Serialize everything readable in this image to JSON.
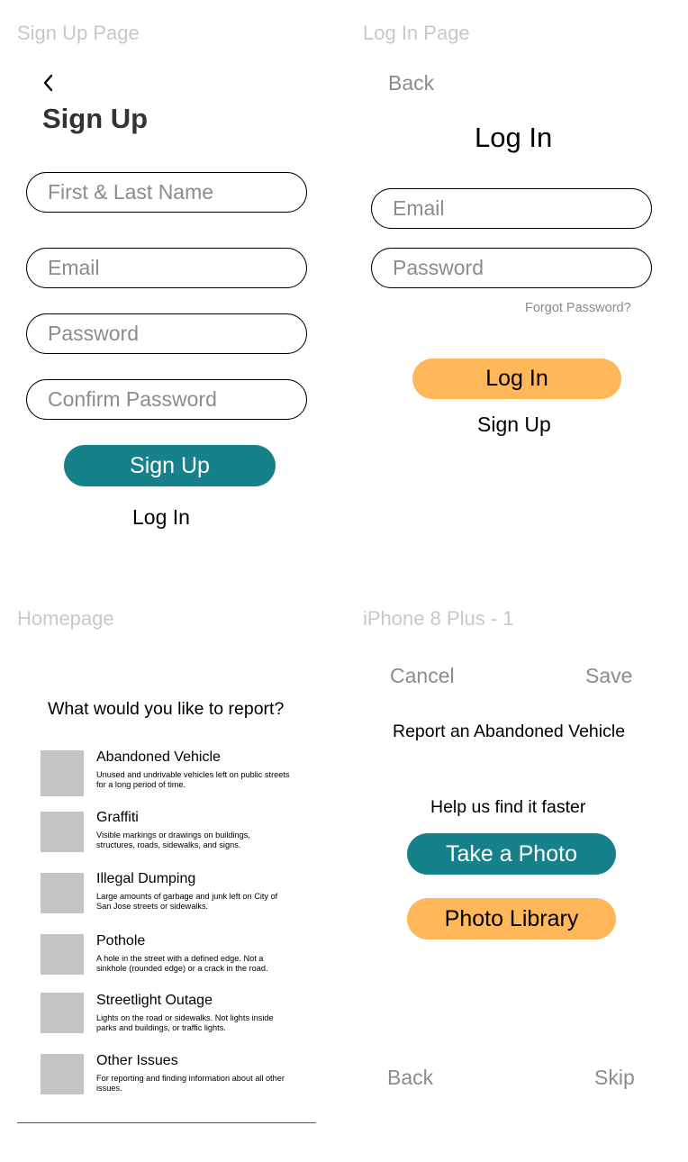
{
  "artboards": {
    "signup": "Sign Up Page",
    "login": "Log In Page",
    "home": "Homepage",
    "iphone": "iPhone 8 Plus - 1"
  },
  "signup": {
    "back_glyph": "‹",
    "title": "Sign Up",
    "name_placeholder": "First & Last Name",
    "email_placeholder": "Email",
    "password_placeholder": "Password",
    "confirm_placeholder": "Confirm Password",
    "submit_label": "Sign Up",
    "login_link": "Log In"
  },
  "login": {
    "back_label": "Back",
    "title": "Log In",
    "email_placeholder": "Email",
    "password_placeholder": "Password",
    "forgot_label": "Forgot Password?",
    "submit_label": "Log In",
    "signup_link": "Sign Up"
  },
  "home": {
    "heading": "What would you like to report?",
    "categories": [
      {
        "title": "Abandoned Vehicle",
        "desc": "Unused and undrivable vehicles left on public streets for a long period of time."
      },
      {
        "title": "Graffiti",
        "desc": "Visible markings or drawings on buildings, structures, roads, sidewalks, and signs."
      },
      {
        "title": "Illegal Dumping",
        "desc": "Large amounts of garbage and junk left on City of San Jose streets or sidewalks."
      },
      {
        "title": "Pothole",
        "desc": "A hole in the street with a defined edge. Not a sinkhole (rounded edge) or a crack in the road."
      },
      {
        "title": "Streetlight Outage",
        "desc": "Lights on the road or sidewalks. Not lights inside parks and buildings, or traffic lights."
      },
      {
        "title": "Other Issues",
        "desc": "For reporting and finding information about all other issues."
      }
    ]
  },
  "report": {
    "cancel_label": "Cancel",
    "save_label": "Save",
    "title": "Report an Abandoned Vehicle",
    "help_text": "Help us find it faster",
    "take_photo_label": "Take a Photo",
    "library_label": "Photo Library",
    "back_label": "Back",
    "skip_label": "Skip"
  },
  "colors": {
    "teal": "#16818a",
    "orange": "#ffb75a",
    "placeholder_gray": "#8c8c8c",
    "artboard_label": "#c8c8c8",
    "thumb_gray": "#c4c4c4"
  }
}
